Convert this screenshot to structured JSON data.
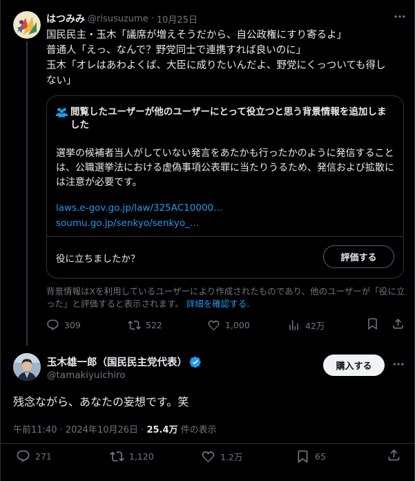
{
  "tweet1": {
    "display_name": "はつみみ",
    "handle": "@risusuzume",
    "separator": "·",
    "date": "10月25日",
    "lines": [
      "国民民主・玉木「議席が増えそうだから、自公政権にすり寄るよ」",
      "普通人「えっ、なんで？野党同士で連携すれば良いのに」",
      "玉木「オレはあわよくば、大臣に成りたいんだよ、野党にくっついても得し",
      "ない」"
    ],
    "community_note": {
      "title": "閲覧したユーザーが他のユーザーにとって役立つと思う背景情報を追加しました",
      "text": "選挙の候補者当人がしていない発言をあたかも行ったかのように発信することは、公職選挙法における虚偽事項公表罪に当たりうるため、発信および拡散には注意が必要です。",
      "links": [
        "laws.e-gov.go.jp/law/325AC10000…",
        "soumu.go.jp/senkyo/senkyo_…"
      ],
      "question": "役に立ちましたか？",
      "rate_label": "評価する",
      "footer": "背景情報はXを利用しているユーザーにより作成されたものであり、他のユーザーが「役に立った」と評価すると表示されます。",
      "footer_link": "詳細を確認する."
    },
    "stats": {
      "replies": "309",
      "reposts": "522",
      "likes": "1,000",
      "views": "42万"
    }
  },
  "tweet2": {
    "display_name": "玉木雄一郎（国民民主党代表）",
    "handle": "@tamakiyuichiro",
    "buy_label": "購入する",
    "text": "残念ながら、あなたの妄想です。笑",
    "time": "午前11:40 · 2024年10月26日 · ",
    "views_count": "25.4万",
    "views_suffix": " 件の表示",
    "stats": {
      "replies": "271",
      "reposts": "1,120",
      "likes": "1.2万",
      "bookmarks": "65"
    }
  },
  "colors": {
    "background": "#000000",
    "text": "#e7e9ea",
    "muted": "#71767b",
    "link": "#1d9bf0",
    "border": "#2f3336",
    "verified": "#1d9bf0"
  },
  "icons": [
    "more-icon",
    "community-note-icon",
    "reply-icon",
    "repost-icon",
    "like-icon",
    "views-icon",
    "bookmark-icon",
    "share-icon",
    "verified-badge-icon"
  ]
}
